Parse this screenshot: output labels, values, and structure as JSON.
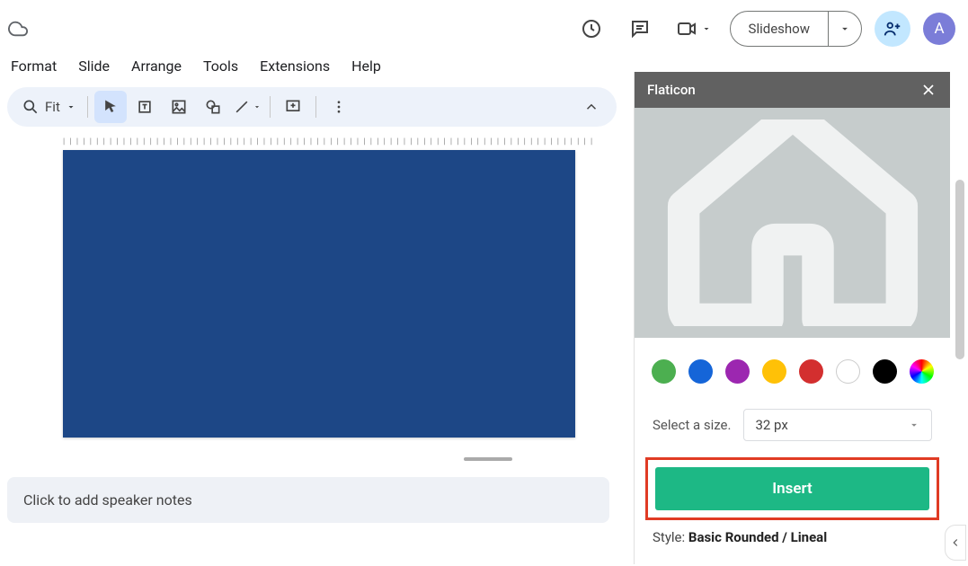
{
  "menus": {
    "format": "Format",
    "slide": "Slide",
    "arrange": "Arrange",
    "tools": "Tools",
    "extensions": "Extensions",
    "help": "Help"
  },
  "toolbar": {
    "zoom": "Fit"
  },
  "actions": {
    "slideshow": "Slideshow"
  },
  "avatar": {
    "initial": "A"
  },
  "notes": {
    "placeholder": "Click to add speaker notes"
  },
  "panel": {
    "title": "Flaticon",
    "colors": [
      "#4caf50",
      "#1565d8",
      "#9c27b0",
      "#ffc107",
      "#d32f2f",
      "#ffffff",
      "#000000",
      "multi"
    ],
    "size_label": "Select a size.",
    "size_value": "32 px",
    "insert_label": "Insert",
    "style_prefix": "Style: ",
    "style_value": "Basic Rounded / Lineal"
  }
}
